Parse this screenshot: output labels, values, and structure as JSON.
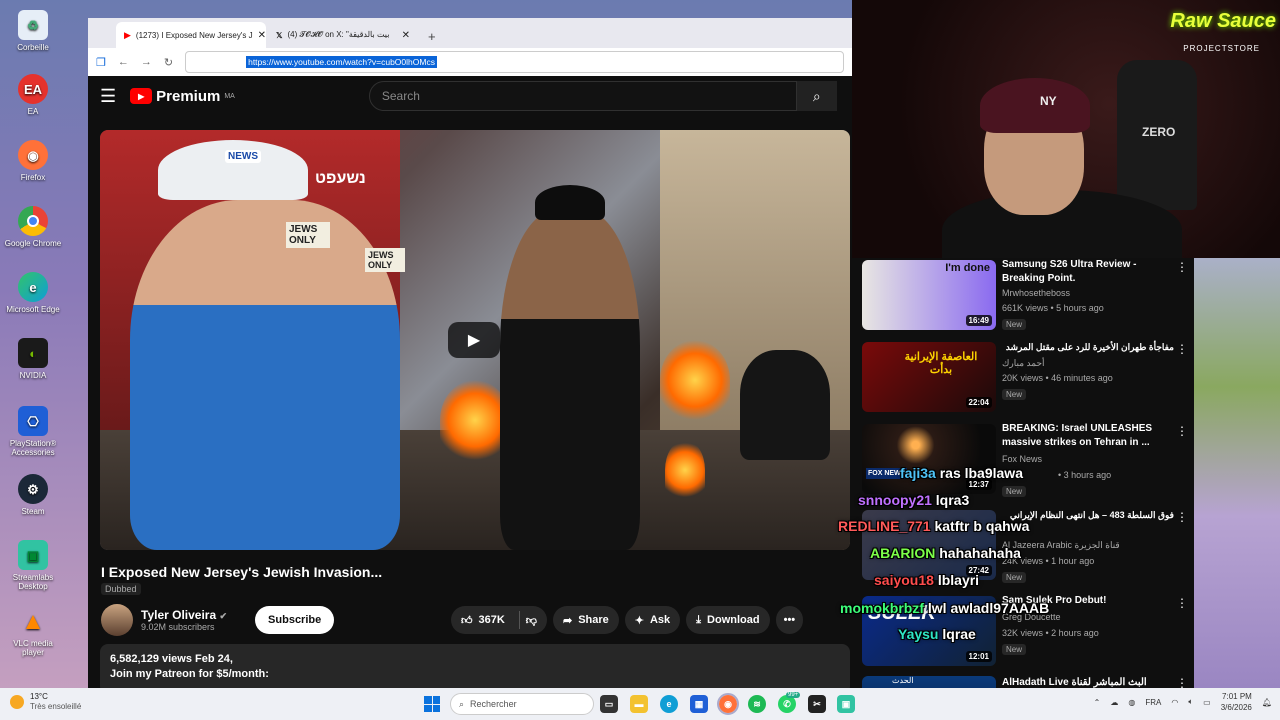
{
  "desktop": {
    "icons": [
      {
        "label": "Corbeille",
        "icon": "recycle-bin-icon",
        "color": "#ffffff"
      },
      {
        "label": "EA",
        "icon": "ea-icon",
        "color": "#e5322d"
      },
      {
        "label": "Firefox",
        "icon": "firefox-icon",
        "color": "#ff7139"
      },
      {
        "label": "Google Chrome",
        "icon": "chrome-icon",
        "color": "#4285f4"
      },
      {
        "label": "Microsoft Edge",
        "icon": "edge-icon",
        "color": "#0f9ed5"
      },
      {
        "label": "NVIDIA",
        "icon": "nvidia-icon",
        "color": "#76b900"
      },
      {
        "label": "PlayStation® Accessories",
        "icon": "playstation-icon",
        "color": "#1f5fd6"
      },
      {
        "label": "Steam",
        "icon": "steam-icon",
        "color": "#1b2838"
      },
      {
        "label": "Streamlabs Desktop",
        "icon": "streamlabs-icon",
        "color": "#31c3a2"
      },
      {
        "label": "VLC media player",
        "icon": "vlc-icon",
        "color": "#ff8800"
      }
    ]
  },
  "browser": {
    "tabs": [
      {
        "label": "(1273) I Exposed New Jersey's J",
        "icon": "youtube-icon"
      },
      {
        "label": "(4) 𝓣𝓞𝓗𝓞 on X: \"بيت بالدقيقة",
        "icon": "x-icon"
      }
    ],
    "url": "https://www.youtube.com/watch?v=cubO0lhOMcs"
  },
  "youtube": {
    "logo": "Premium",
    "region": "MA",
    "search_placeholder": "Search",
    "video_title": "I Exposed New Jersey's Jewish Invasion...",
    "dubbed": "Dubbed",
    "thumb_sign_1": "NEWS",
    "thumb_sign_2": "JEWS ONLY",
    "thumb_sign_3": "JEWS ONLY",
    "thumb_sign_4": "נשעפט",
    "channel": "Tyler Oliveira",
    "subscribers": "9.02M subscribers",
    "subscribe": "Subscribe",
    "likes": "367K",
    "share": "Share",
    "ask": "Ask",
    "download": "Download",
    "views": "6,582,129 views  Feb 24,",
    "desc_line": "Join my Patreon for $5/month:",
    "recommendations": [
      {
        "title": "Samsung S26 Ultra Review - Breaking Point.",
        "channel": "Mrwhosetheboss",
        "stats": "661K views • 5 hours ago",
        "badge": "New",
        "duration": "16:49",
        "overlay": "I'm done"
      },
      {
        "title": "مفاجأة طهران الأخيرة للرد على مقتل المرشد",
        "channel": "أحمد مبارك",
        "stats": "20K views • 46 minutes ago",
        "badge": "New",
        "duration": "22:04",
        "overlay": "العاصفة الإيرانية بدأت"
      },
      {
        "title": "BREAKING: Israel UNLEASHES massive strikes on Tehran in ...",
        "channel": "Fox News",
        "stats": "• 3 hours ago",
        "badge": "New",
        "duration": "12:37",
        "overlay": "FOX NEWS"
      },
      {
        "title": "فوق السلطة 483 – هل انتهى النظام الإيراني",
        "channel": "Al Jazeera Arabic قناة الجزيرة",
        "stats": "24K views • 1 hour ago",
        "badge": "New",
        "duration": "27:42",
        "overlay": ""
      },
      {
        "title": "Sam Sulek Pro Debut!",
        "channel": "Greg Doucette",
        "stats": "32K views • 2 hours ago",
        "badge": "New",
        "duration": "12:01",
        "overlay": "SULEK"
      },
      {
        "title": "AlHadath Live البث المباشر لقناة الحدث",
        "channel": "",
        "stats": "",
        "badge": "",
        "duration": "",
        "overlay": "الحدث"
      }
    ]
  },
  "stream": {
    "brand": "Raw Sauce",
    "brand_sub": "PROJECTSTORE",
    "chair_text": "ZERO",
    "cap_logo": "NY",
    "chat": [
      {
        "user": "faji3a",
        "msg": "ras lba9lawa",
        "color": "#4fc3f7"
      },
      {
        "user": "snnoopy21",
        "msg": "lqra3",
        "color": "#c071ff"
      },
      {
        "user": "REDLINE_771",
        "msg": "katftr b qahwa",
        "color": "#ff5a5a"
      },
      {
        "user": "ABARION",
        "msg": "hahahahaha",
        "color": "#7cff4a"
      },
      {
        "user": "saiyou18",
        "msg": "lblayri",
        "color": "#ff4d4d"
      },
      {
        "user": "momokbrbzf",
        "msg": "lwl awladl97AAAB",
        "color": "#3dff7a"
      },
      {
        "user": "Yaysu",
        "msg": "lqrae",
        "color": "#2ee6c6"
      }
    ]
  },
  "taskbar": {
    "temp": "13°C",
    "weather": "Très ensoleillé",
    "search": "Rechercher",
    "lang": "FRA",
    "time": "7:01 PM",
    "date": "3/6/2026",
    "badge": "99+"
  }
}
